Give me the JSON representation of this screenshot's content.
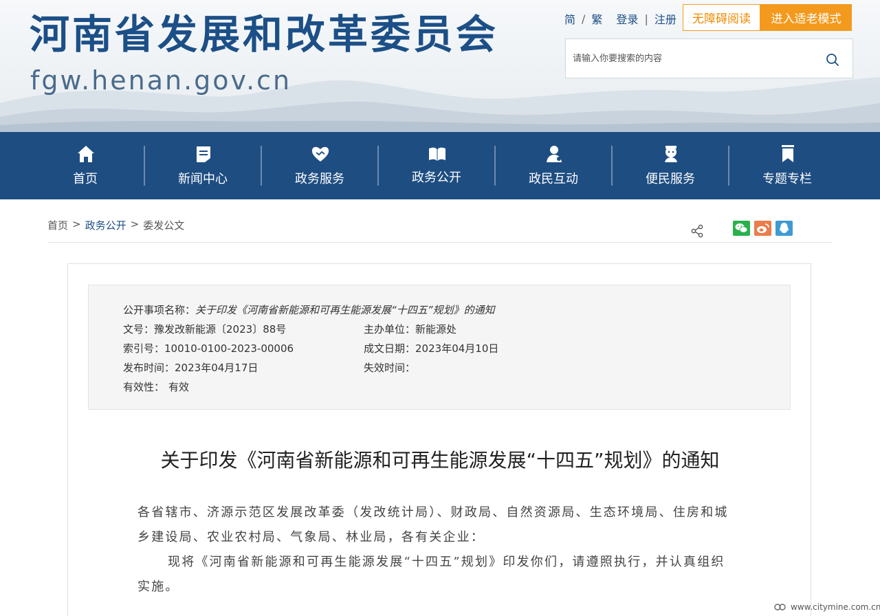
{
  "header": {
    "site_title": "河南省发展和改革委员会",
    "site_domain": "fgw.henan.gov.cn",
    "lang_simplified": "简",
    "lang_sep": "/",
    "lang_traditional": "繁",
    "login": "登录",
    "auth_sep": "|",
    "register": "注册",
    "accessible_reading": "无障碍阅读",
    "elder_mode": "进入适老模式",
    "search_placeholder": "请输入你要搜索的内容"
  },
  "nav": {
    "items": [
      {
        "label": "首页",
        "icon": "home-icon"
      },
      {
        "label": "新闻中心",
        "icon": "news-icon"
      },
      {
        "label": "政务服务",
        "icon": "handshake-heart-icon"
      },
      {
        "label": "政务公开",
        "icon": "open-book-icon"
      },
      {
        "label": "政民互动",
        "icon": "people-interaction-icon"
      },
      {
        "label": "便民服务",
        "icon": "service-person-icon"
      },
      {
        "label": "专题专栏",
        "icon": "bookmark-icon"
      }
    ]
  },
  "breadcrumb": {
    "home": "首页",
    "sep": ">",
    "level1": "政务公开",
    "level2": "委发公文"
  },
  "share": {
    "icons": [
      "share-icon",
      "wechat-icon",
      "weibo-icon",
      "qq-icon"
    ]
  },
  "info": {
    "item_name_label": "公开事项名称：",
    "item_name_value": "关于印发《河南省新能源和可再生能源发展“十四五”规划》的通知",
    "doc_no_label": "文号：",
    "doc_no_value": "豫发改新能源〔2023〕88号",
    "org_label": "主办单位：",
    "org_value": "新能源处",
    "index_label": "索引号：",
    "index_value": "10010-0100-2023-00006",
    "created_label": "成文日期：",
    "created_value": "2023年04月10日",
    "published_label": "发布时间：",
    "published_value": "2023年04月17日",
    "expire_label": "失效时间：",
    "expire_value": "",
    "validity_label": "有效性：",
    "validity_value": "有效"
  },
  "article": {
    "title": "关于印发《河南省新能源和可再生能源发展“十四五”规划》的通知",
    "para1": "各省辖市、济源示范区发展改革委（发改统计局）、财政局、自然资源局、生态环境局、住房和城乡建设局、农业农村局、气象局、林业局，各有关企业：",
    "para2": "现将《河南省新能源和可再生能源发展“十四五”规划》印发你们，请遵照执行，并认真组织实施。"
  },
  "watermark": "www.citymine.com.cn",
  "colors": {
    "brand_blue": "#1e4d82",
    "title_blue": "#1c4f87",
    "accent_orange": "#f39a1e"
  }
}
